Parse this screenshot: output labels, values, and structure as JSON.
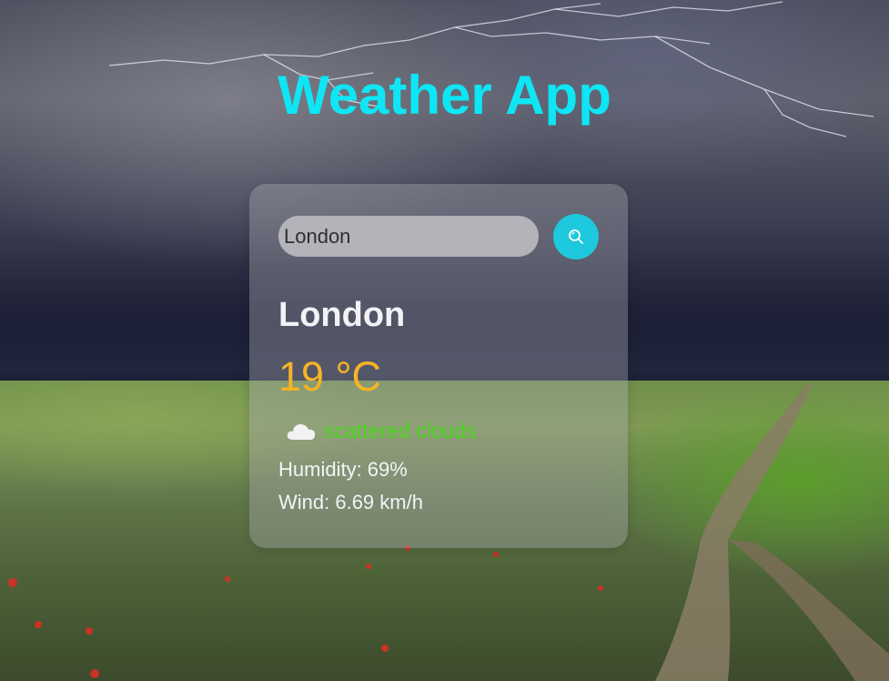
{
  "app": {
    "title": "Weather App"
  },
  "search": {
    "value": "London"
  },
  "weather": {
    "city": "London",
    "temperature": "19 °C",
    "condition": "scattered clouds",
    "condition_icon": "cloud-icon",
    "humidity": "Humidity: 69%",
    "wind": "Wind: 6.69 km/h"
  },
  "colors": {
    "title": "#0ee6f5",
    "temperature": "#f7b325",
    "condition": "#49d81d",
    "search_button": "#1ec9dd"
  }
}
